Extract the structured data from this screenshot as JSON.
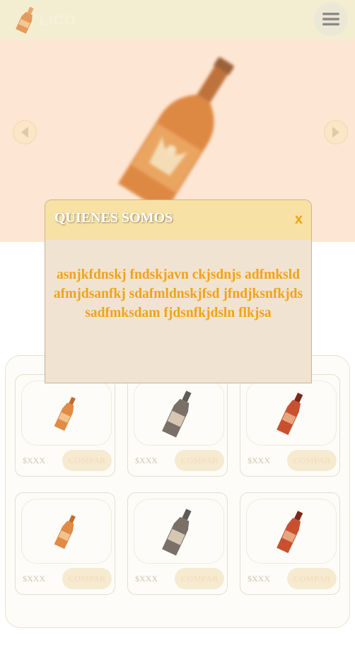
{
  "header": {
    "logo_text": "LICO",
    "logo_icon": "beer-bottle-icon",
    "menu_icon": "hamburger-menu-icon"
  },
  "hero": {
    "prev_icon": "arrow-left-icon",
    "next_icon": "arrow-right-icon"
  },
  "products": [
    {
      "price": "$XXX",
      "buy_label": "COMPAR",
      "bottle": "orange"
    },
    {
      "price": "$XXX",
      "buy_label": "COMPAR",
      "bottle": "gray"
    },
    {
      "price": "$XXX",
      "buy_label": "COMPAR",
      "bottle": "red"
    },
    {
      "price": "$XXX",
      "buy_label": "COMPAR",
      "bottle": "orange"
    },
    {
      "price": "$XXX",
      "buy_label": "COMPAR",
      "bottle": "gray"
    },
    {
      "price": "$XXX",
      "buy_label": "COMPAR",
      "bottle": "red"
    }
  ],
  "modal": {
    "title": "QUIENES SOMOS",
    "close_label": "x",
    "body": "asnjkfdnskj fndskjavn ckjsdnjs adfmksld afmjdsanfkj sdafmldnskjfsd jfndjksnfkjds sadfmksdam fjdsnfkjdsln flkjsa"
  },
  "colors": {
    "header_bg": "#f3eed2",
    "hero_bg": "#fde6d3",
    "modal_bg": "#f1e3d1",
    "modal_header_bg": "#f7e1a4",
    "accent": "#f0a317"
  }
}
